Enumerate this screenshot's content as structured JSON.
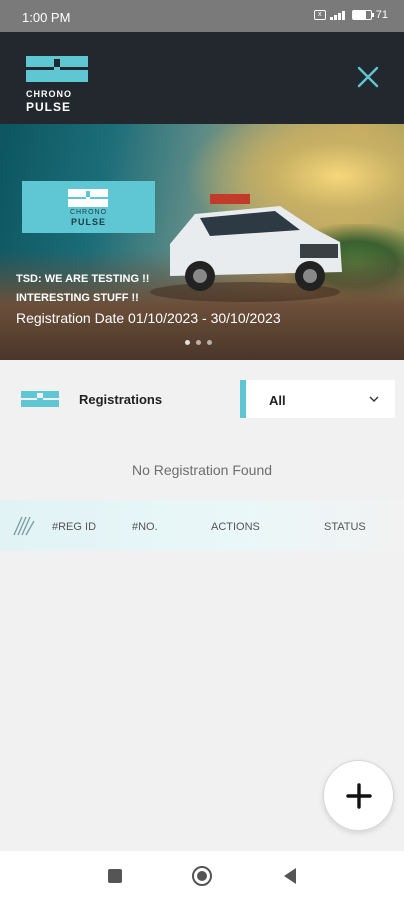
{
  "status_bar": {
    "time": "1:00 PM",
    "battery": "71",
    "battery_level": 0.71,
    "icons": [
      "sim-icon",
      "signal-icon",
      "battery-icon"
    ]
  },
  "app": {
    "logo_line1": "CHRONO",
    "logo_line2": "PULSE",
    "close_icon": "close-icon",
    "accent_color": "#5fc7d3",
    "header_color": "#22282d"
  },
  "banner": {
    "logo_line1": "CHRONO",
    "logo_line2": "PULSE",
    "title_line1": "TSD: WE ARE TESTING !!",
    "title_line2": "INTERESTING STUFF !!",
    "date": "Registration Date 01/10/2023 - 30/10/2023",
    "slide_count": 3,
    "active_slide": 1
  },
  "registrations": {
    "label": "Registrations",
    "filter_value": "All",
    "empty_message": "No Registration Found"
  },
  "table": {
    "columns": [
      "#REG ID",
      "#NO.",
      "ACTIONS",
      "STATUS"
    ]
  },
  "fab": {
    "icon": "plus-icon"
  },
  "nav": {
    "icons": [
      "recent-apps-icon",
      "home-icon",
      "back-icon"
    ]
  }
}
